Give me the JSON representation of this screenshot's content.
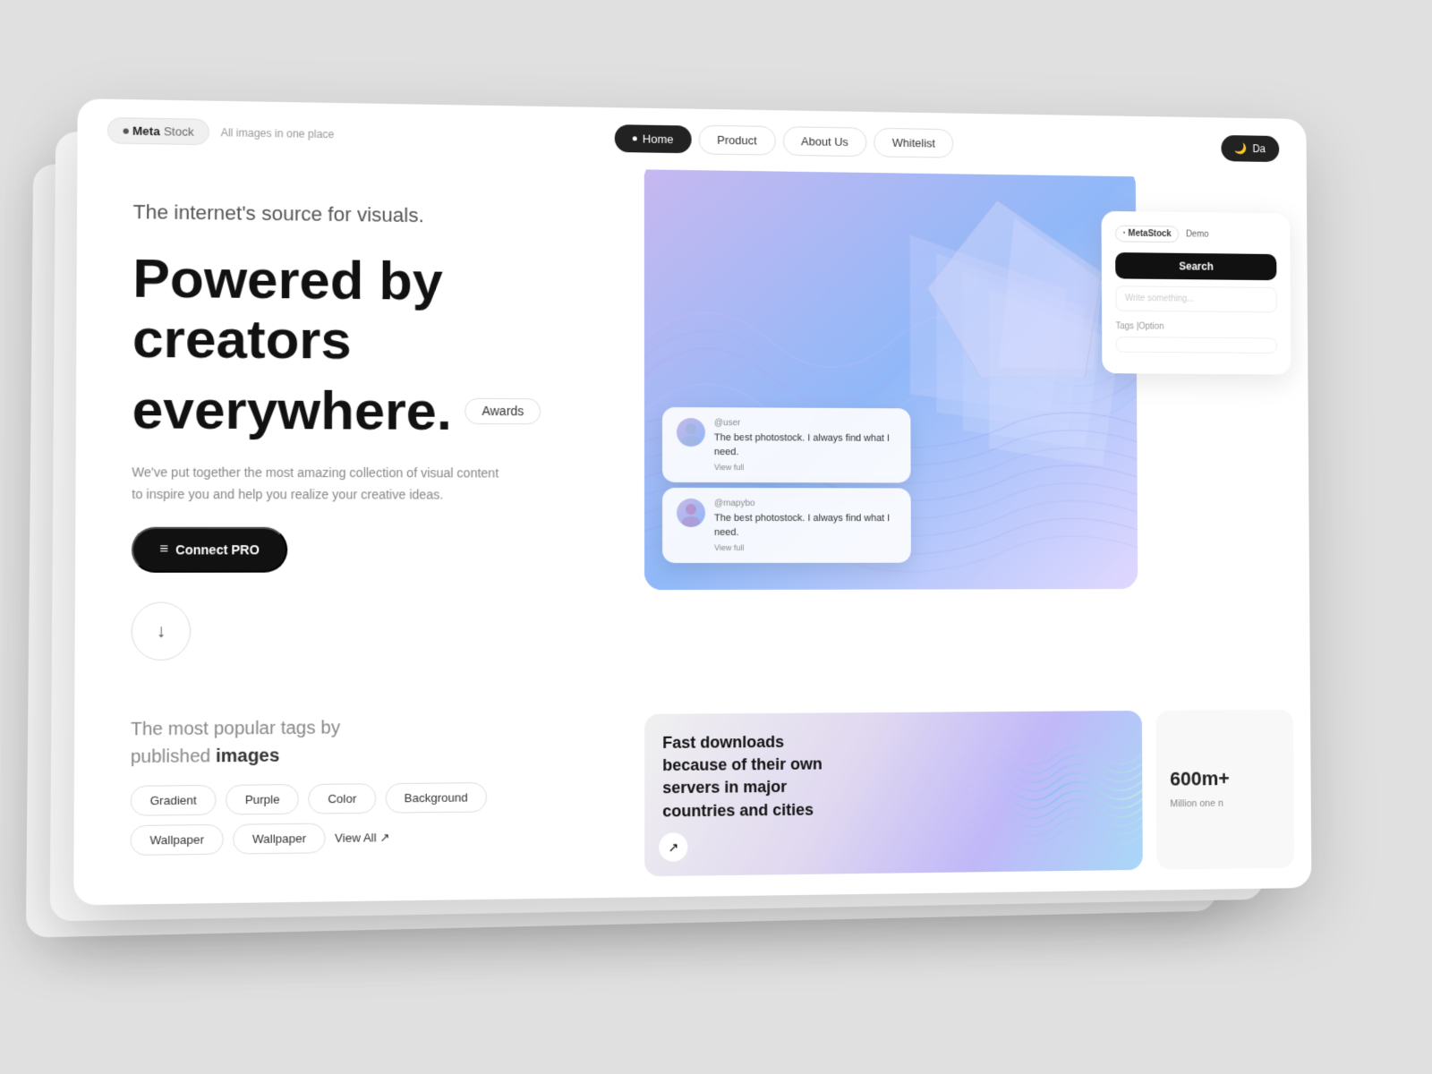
{
  "page": {
    "background": "#e0e0e0"
  },
  "navbar": {
    "logo_prefix": "·",
    "logo_meta": "Meta",
    "logo_stock": "Stock",
    "logo_tagline": "All images in one place",
    "nav_items": [
      {
        "label": "Home",
        "active": true
      },
      {
        "label": "Product",
        "active": false
      },
      {
        "label": "About Us",
        "active": false
      },
      {
        "label": "Whitelist",
        "active": false
      }
    ],
    "dark_toggle_label": "Da",
    "dark_toggle_icon": "🌙"
  },
  "hero": {
    "subtitle": "The internet's source for visuals.",
    "title_line1": "Powered by creators",
    "title_line2": "everywhere.",
    "awards_label": "Awards",
    "description": "We've put together the most amazing collection of visual content to inspire you and help you realize your creative ideas.",
    "connect_label": "Connect PRO",
    "connect_icon": "≡"
  },
  "tags": {
    "title_regular": "The most popular tags by",
    "title_bold_start": "published",
    "title_bold_end": "images",
    "items": [
      "Gradient",
      "Purple",
      "Color",
      "Background",
      "Wallpaper",
      "Wallpaper"
    ],
    "view_all_label": "View All ↗"
  },
  "search_panel": {
    "logo": "· MetaStock",
    "demo_label": "Demo",
    "search_btn_label": "Search",
    "search_placeholder": "Write something...",
    "tags_label": "Tags |Option",
    "tags_placeholder": ""
  },
  "testimonials": [
    {
      "handle": "@user",
      "text": "The best photostock. I always find what I need.",
      "view_full": "View full"
    },
    {
      "handle": "@mapybo",
      "text": "The best photostock. I always find what I need.",
      "view_full": "View full"
    }
  ],
  "fast_downloads": {
    "bold": "Fast downloads",
    "rest": "because of their own servers in major countries and cities",
    "arrow": "↗"
  },
  "stats": {
    "number": "600m+",
    "label": "Million one n"
  }
}
